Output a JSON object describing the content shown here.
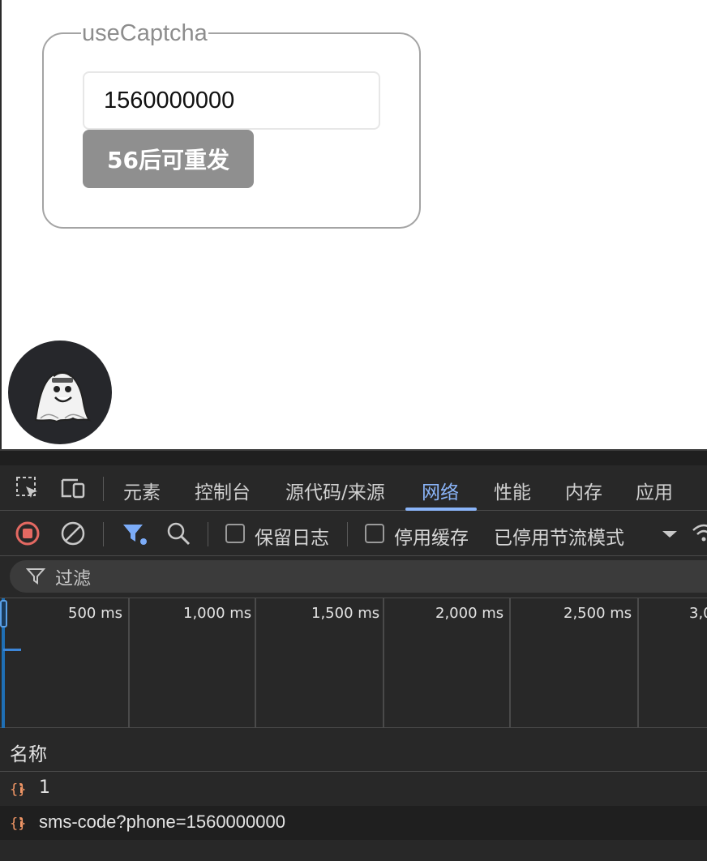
{
  "page": {
    "fieldset_legend": "useCaptcha",
    "phone_value": "1560000000",
    "send_button_label": "56后可重发"
  },
  "devtools": {
    "tabs": [
      {
        "label": "元素",
        "active": false
      },
      {
        "label": "控制台",
        "active": false
      },
      {
        "label": "源代码/来源",
        "active": false
      },
      {
        "label": "网络",
        "active": true
      },
      {
        "label": "性能",
        "active": false
      },
      {
        "label": "内存",
        "active": false
      },
      {
        "label": "应用",
        "active": false
      }
    ],
    "toolbar": {
      "preserve_log_label": "保留日志",
      "disable_cache_label": "停用缓存",
      "throttling_value": "已停用节流模式"
    },
    "filter_label": "过滤",
    "timeline_ticks": [
      "500 ms",
      "1,000 ms",
      "1,500 ms",
      "2,000 ms",
      "2,500 ms",
      "3,0"
    ],
    "table": {
      "name_header": "名称",
      "rows": [
        {
          "name": "1"
        },
        {
          "name": "sms-code?phone=1560000000"
        }
      ]
    },
    "colors": {
      "accent": "#8ab4f8",
      "record": "#e46962",
      "filter_active": "#7cacf8",
      "fetch_icon": "#f29766"
    }
  }
}
